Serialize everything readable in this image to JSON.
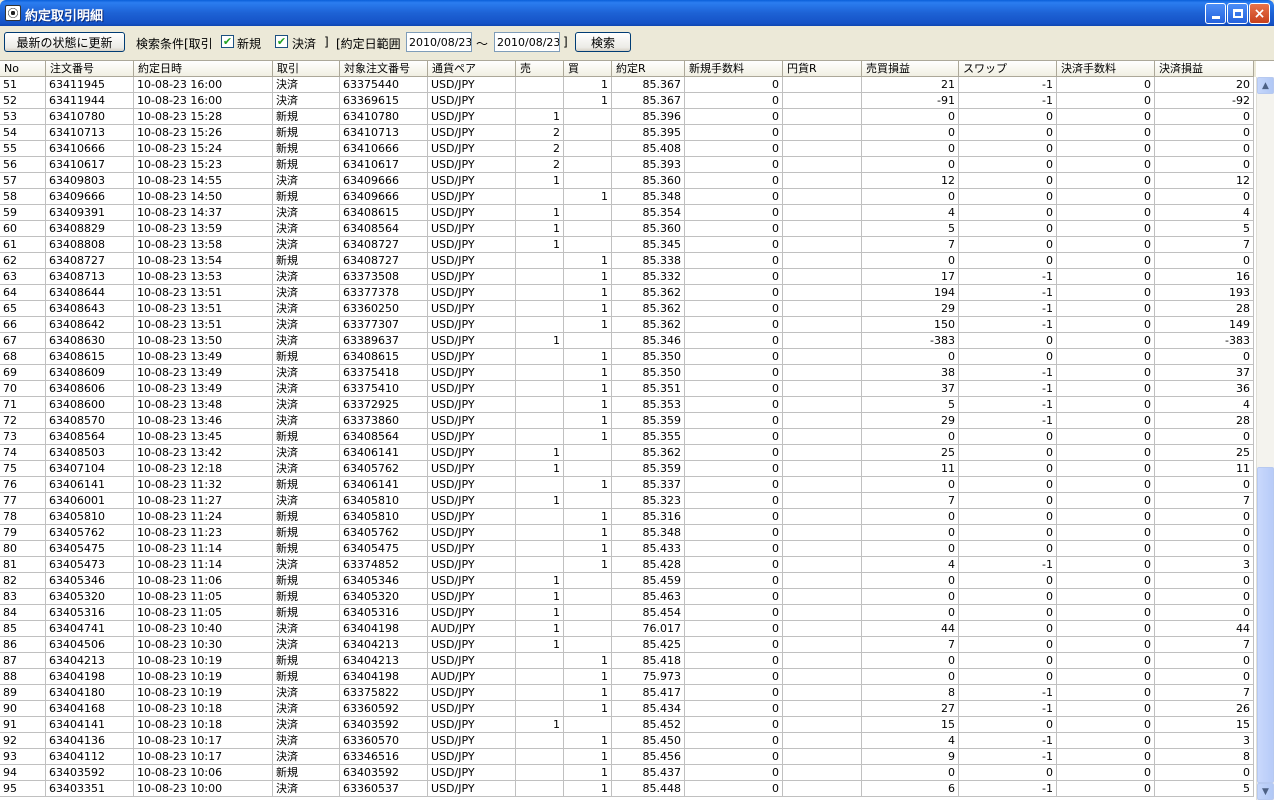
{
  "window": {
    "title": "約定取引明細",
    "minimize_glyph": "_",
    "maximize_glyph": "□",
    "close_glyph": "×"
  },
  "toolbar": {
    "refresh_label": "最新の状態に更新",
    "criteria_label": "検索条件[取引",
    "new_label": "新規",
    "new_checked": true,
    "settle_label": "決済",
    "settle_checked": true,
    "bracket_close": "]",
    "date_range_label": "[約定日範囲",
    "date_from": "2010/08/23",
    "tilde": "〜",
    "date_to": "2010/08/23",
    "bracket_close2": "]",
    "search_label": "検索"
  },
  "grid": {
    "columns": [
      {
        "label": "No",
        "width": 46
      },
      {
        "label": "注文番号",
        "width": 88
      },
      {
        "label": "約定日時",
        "width": 139
      },
      {
        "label": "取引",
        "width": 67
      },
      {
        "label": "対象注文番号",
        "width": 88
      },
      {
        "label": "通貨ペア",
        "width": 88
      },
      {
        "label": "売",
        "width": 48
      },
      {
        "label": "買",
        "width": 48
      },
      {
        "label": "約定R",
        "width": 73
      },
      {
        "label": "新規手数料",
        "width": 98
      },
      {
        "label": "円貨R",
        "width": 79
      },
      {
        "label": "売買損益",
        "width": 97
      },
      {
        "label": "スワップ",
        "width": 98
      },
      {
        "label": "決済手数料",
        "width": 98
      },
      {
        "label": "決済損益",
        "width": 99
      }
    ],
    "rows": [
      [
        "51",
        "63411945",
        "10-08-23 16:00",
        "決済",
        "63375440",
        "USD/JPY",
        "",
        "1",
        "85.367",
        "0",
        "",
        "21",
        "-1",
        "0",
        "20"
      ],
      [
        "52",
        "63411944",
        "10-08-23 16:00",
        "決済",
        "63369615",
        "USD/JPY",
        "",
        "1",
        "85.367",
        "0",
        "",
        "-91",
        "-1",
        "0",
        "-92"
      ],
      [
        "53",
        "63410780",
        "10-08-23 15:28",
        "新規",
        "63410780",
        "USD/JPY",
        "1",
        "",
        "85.396",
        "0",
        "",
        "0",
        "0",
        "0",
        "0"
      ],
      [
        "54",
        "63410713",
        "10-08-23 15:26",
        "新規",
        "63410713",
        "USD/JPY",
        "2",
        "",
        "85.395",
        "0",
        "",
        "0",
        "0",
        "0",
        "0"
      ],
      [
        "55",
        "63410666",
        "10-08-23 15:24",
        "新規",
        "63410666",
        "USD/JPY",
        "2",
        "",
        "85.408",
        "0",
        "",
        "0",
        "0",
        "0",
        "0"
      ],
      [
        "56",
        "63410617",
        "10-08-23 15:23",
        "新規",
        "63410617",
        "USD/JPY",
        "2",
        "",
        "85.393",
        "0",
        "",
        "0",
        "0",
        "0",
        "0"
      ],
      [
        "57",
        "63409803",
        "10-08-23 14:55",
        "決済",
        "63409666",
        "USD/JPY",
        "1",
        "",
        "85.360",
        "0",
        "",
        "12",
        "0",
        "0",
        "12"
      ],
      [
        "58",
        "63409666",
        "10-08-23 14:50",
        "新規",
        "63409666",
        "USD/JPY",
        "",
        "1",
        "85.348",
        "0",
        "",
        "0",
        "0",
        "0",
        "0"
      ],
      [
        "59",
        "63409391",
        "10-08-23 14:37",
        "決済",
        "63408615",
        "USD/JPY",
        "1",
        "",
        "85.354",
        "0",
        "",
        "4",
        "0",
        "0",
        "4"
      ],
      [
        "60",
        "63408829",
        "10-08-23 13:59",
        "決済",
        "63408564",
        "USD/JPY",
        "1",
        "",
        "85.360",
        "0",
        "",
        "5",
        "0",
        "0",
        "5"
      ],
      [
        "61",
        "63408808",
        "10-08-23 13:58",
        "決済",
        "63408727",
        "USD/JPY",
        "1",
        "",
        "85.345",
        "0",
        "",
        "7",
        "0",
        "0",
        "7"
      ],
      [
        "62",
        "63408727",
        "10-08-23 13:54",
        "新規",
        "63408727",
        "USD/JPY",
        "",
        "1",
        "85.338",
        "0",
        "",
        "0",
        "0",
        "0",
        "0"
      ],
      [
        "63",
        "63408713",
        "10-08-23 13:53",
        "決済",
        "63373508",
        "USD/JPY",
        "",
        "1",
        "85.332",
        "0",
        "",
        "17",
        "-1",
        "0",
        "16"
      ],
      [
        "64",
        "63408644",
        "10-08-23 13:51",
        "決済",
        "63377378",
        "USD/JPY",
        "",
        "1",
        "85.362",
        "0",
        "",
        "194",
        "-1",
        "0",
        "193"
      ],
      [
        "65",
        "63408643",
        "10-08-23 13:51",
        "決済",
        "63360250",
        "USD/JPY",
        "",
        "1",
        "85.362",
        "0",
        "",
        "29",
        "-1",
        "0",
        "28"
      ],
      [
        "66",
        "63408642",
        "10-08-23 13:51",
        "決済",
        "63377307",
        "USD/JPY",
        "",
        "1",
        "85.362",
        "0",
        "",
        "150",
        "-1",
        "0",
        "149"
      ],
      [
        "67",
        "63408630",
        "10-08-23 13:50",
        "決済",
        "63389637",
        "USD/JPY",
        "1",
        "",
        "85.346",
        "0",
        "",
        "-383",
        "0",
        "0",
        "-383"
      ],
      [
        "68",
        "63408615",
        "10-08-23 13:49",
        "新規",
        "63408615",
        "USD/JPY",
        "",
        "1",
        "85.350",
        "0",
        "",
        "0",
        "0",
        "0",
        "0"
      ],
      [
        "69",
        "63408609",
        "10-08-23 13:49",
        "決済",
        "63375418",
        "USD/JPY",
        "",
        "1",
        "85.350",
        "0",
        "",
        "38",
        "-1",
        "0",
        "37"
      ],
      [
        "70",
        "63408606",
        "10-08-23 13:49",
        "決済",
        "63375410",
        "USD/JPY",
        "",
        "1",
        "85.351",
        "0",
        "",
        "37",
        "-1",
        "0",
        "36"
      ],
      [
        "71",
        "63408600",
        "10-08-23 13:48",
        "決済",
        "63372925",
        "USD/JPY",
        "",
        "1",
        "85.353",
        "0",
        "",
        "5",
        "-1",
        "0",
        "4"
      ],
      [
        "72",
        "63408570",
        "10-08-23 13:46",
        "決済",
        "63373860",
        "USD/JPY",
        "",
        "1",
        "85.359",
        "0",
        "",
        "29",
        "-1",
        "0",
        "28"
      ],
      [
        "73",
        "63408564",
        "10-08-23 13:45",
        "新規",
        "63408564",
        "USD/JPY",
        "",
        "1",
        "85.355",
        "0",
        "",
        "0",
        "0",
        "0",
        "0"
      ],
      [
        "74",
        "63408503",
        "10-08-23 13:42",
        "決済",
        "63406141",
        "USD/JPY",
        "1",
        "",
        "85.362",
        "0",
        "",
        "25",
        "0",
        "0",
        "25"
      ],
      [
        "75",
        "63407104",
        "10-08-23 12:18",
        "決済",
        "63405762",
        "USD/JPY",
        "1",
        "",
        "85.359",
        "0",
        "",
        "11",
        "0",
        "0",
        "11"
      ],
      [
        "76",
        "63406141",
        "10-08-23 11:32",
        "新規",
        "63406141",
        "USD/JPY",
        "",
        "1",
        "85.337",
        "0",
        "",
        "0",
        "0",
        "0",
        "0"
      ],
      [
        "77",
        "63406001",
        "10-08-23 11:27",
        "決済",
        "63405810",
        "USD/JPY",
        "1",
        "",
        "85.323",
        "0",
        "",
        "7",
        "0",
        "0",
        "7"
      ],
      [
        "78",
        "63405810",
        "10-08-23 11:24",
        "新規",
        "63405810",
        "USD/JPY",
        "",
        "1",
        "85.316",
        "0",
        "",
        "0",
        "0",
        "0",
        "0"
      ],
      [
        "79",
        "63405762",
        "10-08-23 11:23",
        "新規",
        "63405762",
        "USD/JPY",
        "",
        "1",
        "85.348",
        "0",
        "",
        "0",
        "0",
        "0",
        "0"
      ],
      [
        "80",
        "63405475",
        "10-08-23 11:14",
        "新規",
        "63405475",
        "USD/JPY",
        "",
        "1",
        "85.433",
        "0",
        "",
        "0",
        "0",
        "0",
        "0"
      ],
      [
        "81",
        "63405473",
        "10-08-23 11:14",
        "決済",
        "63374852",
        "USD/JPY",
        "",
        "1",
        "85.428",
        "0",
        "",
        "4",
        "-1",
        "0",
        "3"
      ],
      [
        "82",
        "63405346",
        "10-08-23 11:06",
        "新規",
        "63405346",
        "USD/JPY",
        "1",
        "",
        "85.459",
        "0",
        "",
        "0",
        "0",
        "0",
        "0"
      ],
      [
        "83",
        "63405320",
        "10-08-23 11:05",
        "新規",
        "63405320",
        "USD/JPY",
        "1",
        "",
        "85.463",
        "0",
        "",
        "0",
        "0",
        "0",
        "0"
      ],
      [
        "84",
        "63405316",
        "10-08-23 11:05",
        "新規",
        "63405316",
        "USD/JPY",
        "1",
        "",
        "85.454",
        "0",
        "",
        "0",
        "0",
        "0",
        "0"
      ],
      [
        "85",
        "63404741",
        "10-08-23 10:40",
        "決済",
        "63404198",
        "AUD/JPY",
        "1",
        "",
        "76.017",
        "0",
        "",
        "44",
        "0",
        "0",
        "44"
      ],
      [
        "86",
        "63404506",
        "10-08-23 10:30",
        "決済",
        "63404213",
        "USD/JPY",
        "1",
        "",
        "85.425",
        "0",
        "",
        "7",
        "0",
        "0",
        "7"
      ],
      [
        "87",
        "63404213",
        "10-08-23 10:19",
        "新規",
        "63404213",
        "USD/JPY",
        "",
        "1",
        "85.418",
        "0",
        "",
        "0",
        "0",
        "0",
        "0"
      ],
      [
        "88",
        "63404198",
        "10-08-23 10:19",
        "新規",
        "63404198",
        "AUD/JPY",
        "",
        "1",
        "75.973",
        "0",
        "",
        "0",
        "0",
        "0",
        "0"
      ],
      [
        "89",
        "63404180",
        "10-08-23 10:19",
        "決済",
        "63375822",
        "USD/JPY",
        "",
        "1",
        "85.417",
        "0",
        "",
        "8",
        "-1",
        "0",
        "7"
      ],
      [
        "90",
        "63404168",
        "10-08-23 10:18",
        "決済",
        "63360592",
        "USD/JPY",
        "",
        "1",
        "85.434",
        "0",
        "",
        "27",
        "-1",
        "0",
        "26"
      ],
      [
        "91",
        "63404141",
        "10-08-23 10:18",
        "決済",
        "63403592",
        "USD/JPY",
        "1",
        "",
        "85.452",
        "0",
        "",
        "15",
        "0",
        "0",
        "15"
      ],
      [
        "92",
        "63404136",
        "10-08-23 10:17",
        "決済",
        "63360570",
        "USD/JPY",
        "",
        "1",
        "85.450",
        "0",
        "",
        "4",
        "-1",
        "0",
        "3"
      ],
      [
        "93",
        "63404112",
        "10-08-23 10:17",
        "決済",
        "63346516",
        "USD/JPY",
        "",
        "1",
        "85.456",
        "0",
        "",
        "9",
        "-1",
        "0",
        "8"
      ],
      [
        "94",
        "63403592",
        "10-08-23 10:06",
        "新規",
        "63403592",
        "USD/JPY",
        "",
        "1",
        "85.437",
        "0",
        "",
        "0",
        "0",
        "0",
        "0"
      ],
      [
        "95",
        "63403351",
        "10-08-23 10:00",
        "決済",
        "63360537",
        "USD/JPY",
        "",
        "1",
        "85.448",
        "0",
        "",
        "6",
        "-1",
        "0",
        "5"
      ]
    ]
  },
  "scrollbar": {
    "up_glyph": "▲",
    "down_glyph": "▼"
  }
}
